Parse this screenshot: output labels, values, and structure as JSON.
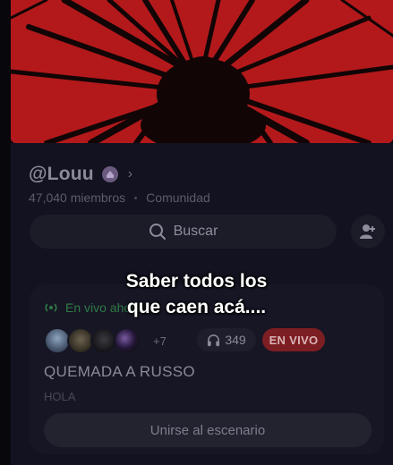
{
  "community": {
    "handle": "@Louu",
    "members": "47,040 miembros",
    "type": "Comunidad",
    "verified_icon": "badge-icon",
    "chevron_icon": "chevron-right-icon"
  },
  "search": {
    "label": "Buscar",
    "icon": "search-icon"
  },
  "actions": {
    "add_member_icon": "add-user-icon"
  },
  "stage": {
    "live_label": "En vivo ahora",
    "extra_participants": "+7",
    "listeners": "349",
    "live_badge": "EN VIVO",
    "title": "QUEMADA A RUSSO",
    "subtitle": "HOLA",
    "join_label": "Unirse al escenario"
  },
  "overlay": {
    "caption_line1": "Saber todos los",
    "caption_line2": "que caen acá...."
  },
  "colors": {
    "banner_red": "#b3191b",
    "live_green": "#2f7a45",
    "live_badge": "#7d1e23",
    "background": "#0b0a12"
  }
}
